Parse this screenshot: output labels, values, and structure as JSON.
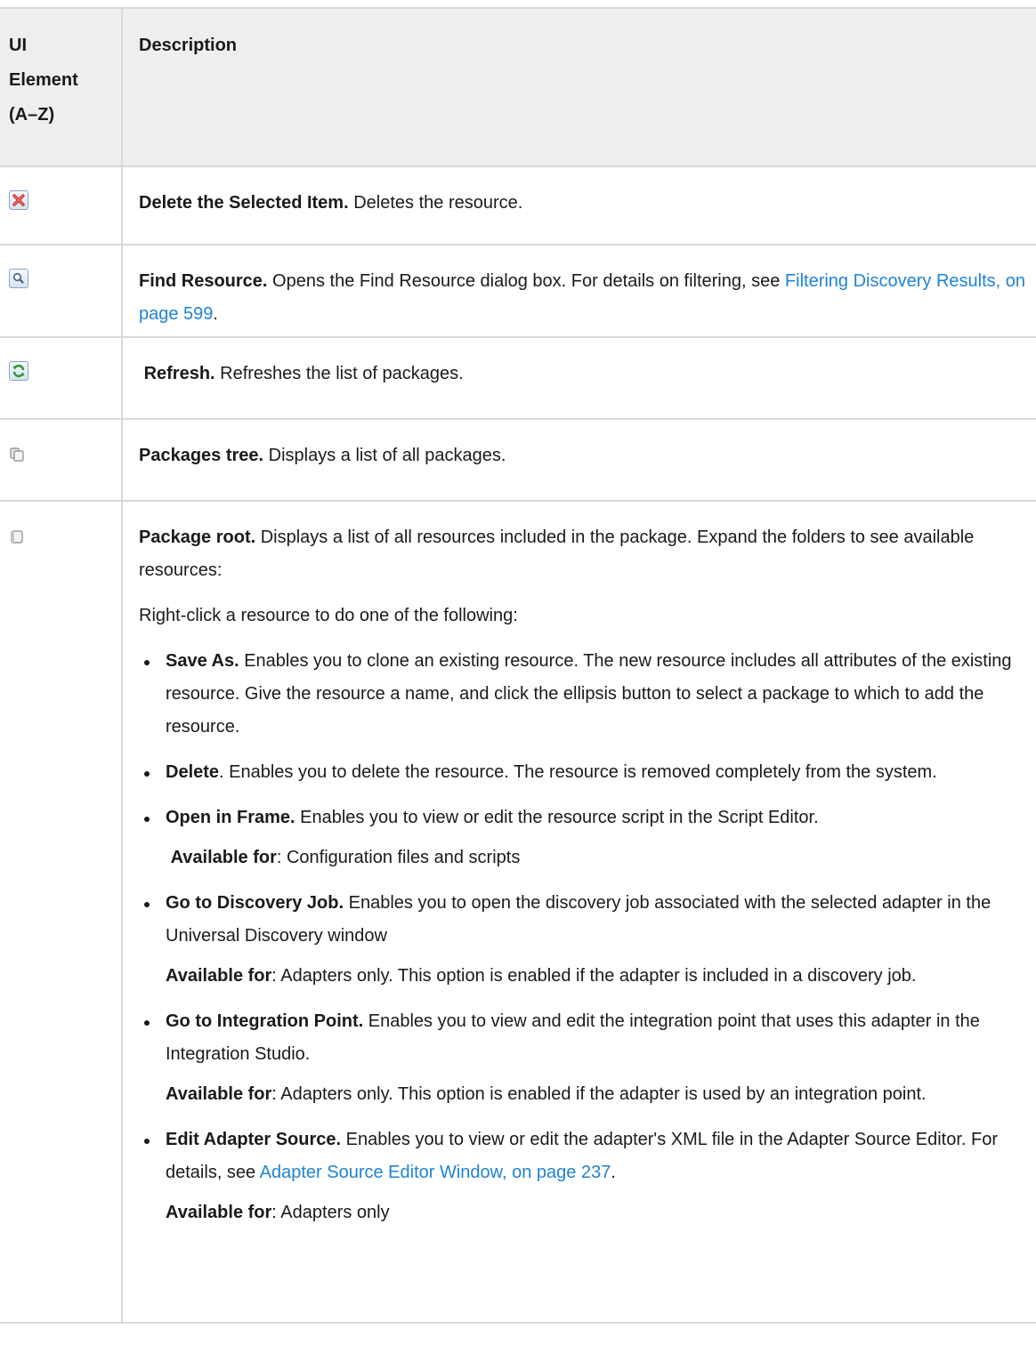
{
  "header": {
    "col1": "UI Element (A–Z)",
    "col1_lines": [
      "UI",
      "Element",
      "(A–Z)"
    ],
    "col2": "Description"
  },
  "rows": [
    {
      "icon": "delete-icon",
      "title": "Delete the Selected Item.",
      "text": " Deletes the resource."
    },
    {
      "icon": "find-icon",
      "title": "Find Resource.",
      "text": " Opens the Find Resource dialog box. For details on filtering, see ",
      "link": "Filtering Discovery Results, on page 599",
      "after": "."
    },
    {
      "icon": "refresh-icon",
      "title": "Refresh.",
      "text": " Refreshes the list of packages."
    },
    {
      "icon": "packages-tree-icon",
      "title": "Packages tree.",
      "text": " Displays a list of all packages."
    },
    {
      "icon": "package-root-icon",
      "title": "Package root.",
      "text": " Displays a list of all resources included in the package. Expand the folders to see available resources:",
      "intro": "Right-click a resource to do one of the following:",
      "options": [
        {
          "title": "Save As.",
          "text": " Enables you to clone an existing resource. The new resource includes all attributes of the existing resource. Give the resource a name, and click the ellipsis button to select a package to which to add the resource."
        },
        {
          "title": "Delete",
          "text": ". Enables you to delete the resource. The resource is removed completely from the system."
        },
        {
          "title": "Open in Frame.",
          "text": " Enables you to view or edit the resource script in the Script Editor.",
          "avail_label": "Available for",
          "avail_text": ": Configuration files and scripts"
        },
        {
          "title": "Go to Discovery Job.",
          "text": " Enables you to open the discovery job associated with the selected adapter in the Universal Discovery window",
          "avail_label": "Available for",
          "avail_text": ": Adapters only. This option is enabled if the adapter is included in a discovery job."
        },
        {
          "title": "Go to Integration Point.",
          "text": " Enables you to view and edit the integration point that uses this adapter in the Integration Studio.",
          "avail_label": "Available for",
          "avail_text": ": Adapters only. This option is enabled if the adapter is used by an integration point."
        },
        {
          "title": "Edit Adapter Source.",
          "text": " Enables you to view or edit the adapter's XML file in the Adapter Source Editor. For details, see ",
          "link": "Adapter Source Editor Window, on page 237",
          "after": ".",
          "avail_label": "Available for",
          "avail_text": ": Adapters only"
        }
      ]
    }
  ]
}
